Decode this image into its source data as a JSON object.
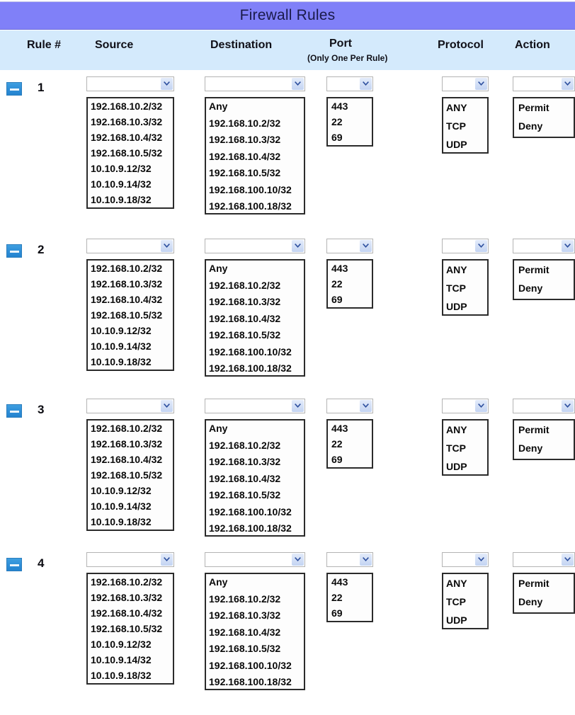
{
  "title": "Firewall Rules",
  "columns": {
    "rule": "Rule #",
    "source": "Source",
    "destination": "Destination",
    "port": "Port",
    "port_sub": "(Only One Per Rule)",
    "protocol": "Protocol",
    "action": "Action"
  },
  "options": {
    "source": [
      "192.168.10.2/32",
      "192.168.10.3/32",
      "192.168.10.4/32",
      "192.168.10.5/32",
      "10.10.9.12/32",
      "10.10.9.14/32",
      "10.10.9.18/32"
    ],
    "destination": [
      "Any",
      "192.168.10.2/32",
      "192.168.10.3/32",
      "192.168.10.4/32",
      "192.168.10.5/32",
      "192.168.100.10/32",
      "192.168.100.18/32"
    ],
    "port": [
      "443",
      "22",
      "69"
    ],
    "protocol": [
      "ANY",
      "TCP",
      "UDP"
    ],
    "action": [
      "Permit",
      "Deny"
    ]
  },
  "rows": [
    {
      "number": "1",
      "source_value": "",
      "destination_value": "",
      "port_value": "",
      "protocol_value": "",
      "action_value": ""
    },
    {
      "number": "2",
      "source_value": "",
      "destination_value": "",
      "port_value": "",
      "protocol_value": "",
      "action_value": ""
    },
    {
      "number": "3",
      "source_value": "",
      "destination_value": "",
      "port_value": "",
      "protocol_value": "",
      "action_value": ""
    },
    {
      "number": "4",
      "source_value": "",
      "destination_value": "",
      "port_value": "",
      "protocol_value": "",
      "action_value": ""
    }
  ],
  "icons": {
    "collapse": "minus-icon",
    "dropdown": "chevron-down-icon"
  },
  "colors": {
    "title_bar": "#8080f8",
    "header_row": "#d4eafc",
    "collapse_button": "#2f8fd8",
    "dropdown_arrow": "#2d4f9e"
  }
}
